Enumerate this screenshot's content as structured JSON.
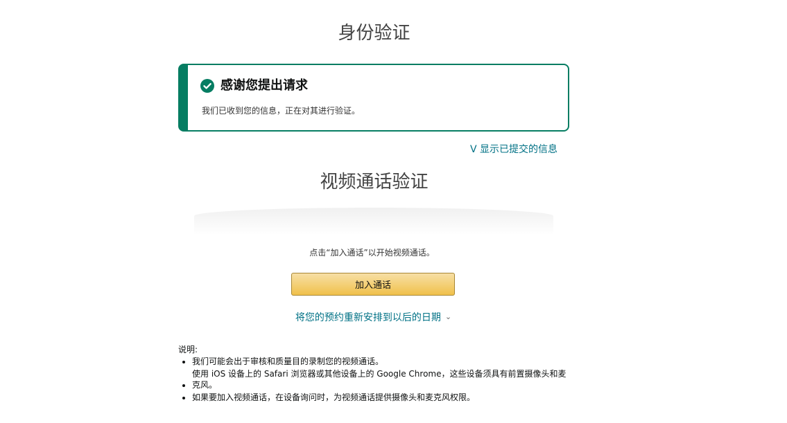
{
  "page": {
    "title": "身份验证"
  },
  "alert": {
    "title": "感谢您提出请求",
    "body": "我们已收到您的信息，正在对其进行验证。",
    "accent_color": "#067d62"
  },
  "show_submitted": {
    "label": "V 显示已提交的信息"
  },
  "video_section": {
    "title": "视频通话验证",
    "instruction": "点击“加入通话”以开始视频通话。",
    "join_button_label": "加入通话",
    "reschedule_label": "将您的预约重新安排到以后的日期",
    "link_color": "#007185"
  },
  "notes": {
    "label": "说明:",
    "items": [
      "我们可能会出于审核和质量目的录制您的视频通话。",
      "使用 iOS 设备上的 Safari 浏览器或其他设备上的 Google Chrome，这些设备须具有前置摄像头和麦克风。",
      "如果要加入视频通话，在设备询问时，为视频通话提供摄像头和麦克风权限。"
    ]
  }
}
